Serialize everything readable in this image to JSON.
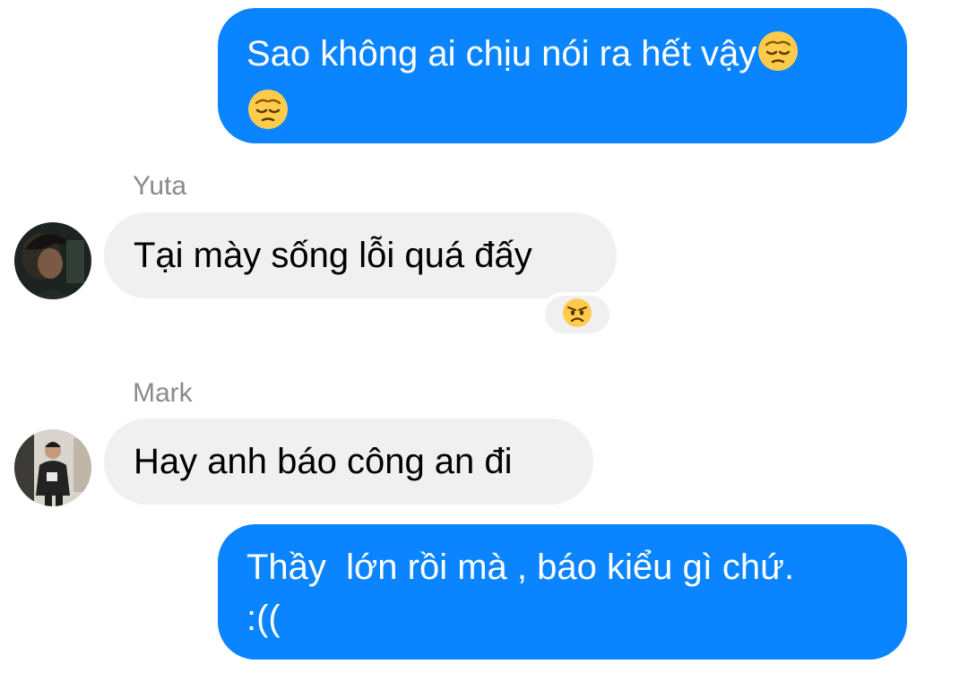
{
  "colors": {
    "outgoing_bubble": "#0a84ff",
    "incoming_bubble": "#f0f0f0",
    "sender_name": "#8a8a8a"
  },
  "messages": [
    {
      "direction": "outgoing",
      "text": "Sao không ai chịu nói ra hết vậy",
      "emojis": [
        "pensive-face-emoji",
        "pensive-face-emoji"
      ]
    },
    {
      "direction": "incoming",
      "sender": "Yuta",
      "avatar": "avatar-yuta",
      "text": "Tại mày sống lỗi quá đấy",
      "reaction": "angry-face-emoji"
    },
    {
      "direction": "incoming",
      "sender": "Mark",
      "avatar": "avatar-mark",
      "text": "Hay anh báo công an đi"
    },
    {
      "direction": "outgoing",
      "text_line1": "Thầy  lớn rồi mà , báo kiểu gì chứ.",
      "text_line2": ":(("
    }
  ]
}
